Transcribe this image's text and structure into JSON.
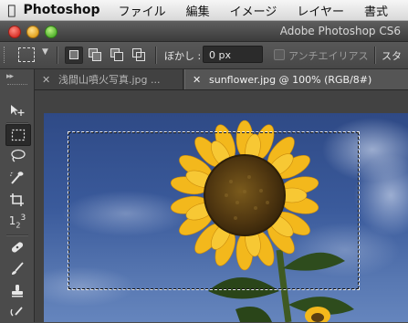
{
  "menubar": {
    "app_name": "Photoshop",
    "items": [
      "ファイル",
      "編集",
      "イメージ",
      "レイヤー",
      "書式"
    ]
  },
  "window": {
    "title": "Adobe Photoshop CS6"
  },
  "options": {
    "feather_label": "ぼかし :",
    "feather_value": "0 px",
    "antialias_label": "アンチエイリアス",
    "style_label": "スタ"
  },
  "tabs": [
    {
      "label": "浅間山噴火写真.jpg ...",
      "active": false
    },
    {
      "label": "sunflower.jpg @ 100% (RGB/8#)",
      "active": true
    }
  ],
  "tools": [
    {
      "name": "move-tool",
      "icon": "▸✥"
    },
    {
      "name": "rectangular-marquee-tool",
      "icon": "⬚",
      "active": true
    },
    {
      "name": "lasso-tool",
      "icon": "ℓ"
    },
    {
      "name": "quick-selection-tool",
      "icon": "✎"
    },
    {
      "name": "crop-tool",
      "icon": "⌗"
    },
    {
      "name": "eyedropper-tool",
      "icon": "1₂3"
    },
    {
      "name": "spot-healing-brush-tool",
      "icon": "✚"
    },
    {
      "name": "brush-tool",
      "icon": "✏"
    },
    {
      "name": "clone-stamp-tool",
      "icon": "⊥"
    }
  ],
  "colors": {
    "sky": "#3a5a9b",
    "petal": "#f3b81c",
    "center": "#5a3f12",
    "leaf": "#2c4a1c"
  }
}
